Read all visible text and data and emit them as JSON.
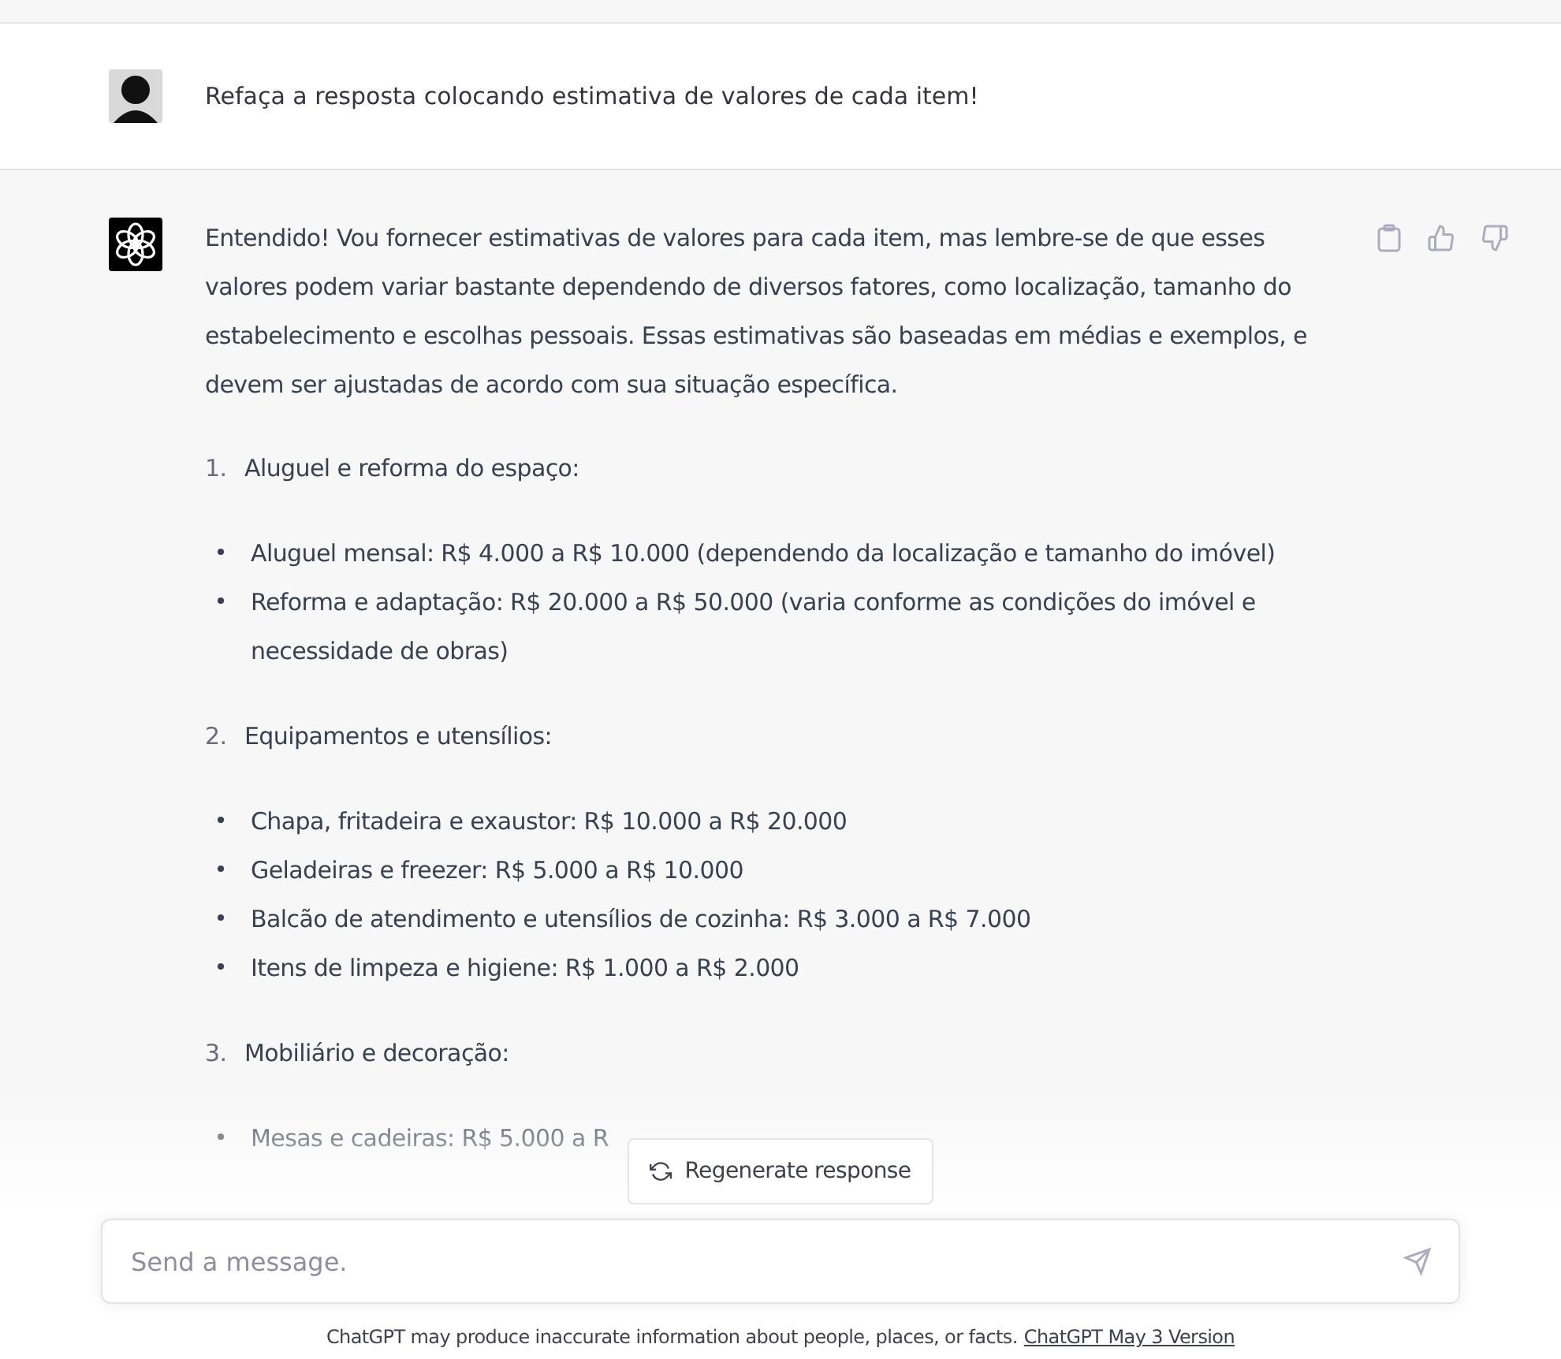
{
  "user_message": {
    "text": "Refaça a resposta colocando estimativa de valores de cada item!"
  },
  "assistant_message": {
    "intro": "Entendido! Vou fornecer estimativas de valores para cada item, mas lembre-se de que esses valores podem variar bastante dependendo de diversos fatores, como localização, tamanho do estabelecimento e escolhas pessoais. Essas estimativas são baseadas em médias e exemplos, e devem ser ajustadas de acordo com sua situação específica.",
    "sections": [
      {
        "number": "1.",
        "title": "Aluguel e reforma do espaço:",
        "items": [
          "Aluguel mensal: R$ 4.000 a R$ 10.000 (dependendo da localização e tamanho do imóvel)",
          "Reforma e adaptação: R$ 20.000 a R$ 50.000 (varia conforme as condições do imóvel e necessidade de obras)"
        ]
      },
      {
        "number": "2.",
        "title": "Equipamentos e utensílios:",
        "items": [
          "Chapa, fritadeira e exaustor: R$ 10.000 a R$ 20.000",
          "Geladeiras e freezer: R$ 5.000 a R$ 10.000",
          "Balcão de atendimento e utensílios de cozinha: R$ 3.000 a R$ 7.000",
          "Itens de limpeza e higiene: R$ 1.000 a R$ 2.000"
        ]
      },
      {
        "number": "3.",
        "title": "Mobiliário e decoração:",
        "items": [
          "Mesas e cadeiras: R$ 5.000 a R"
        ]
      }
    ]
  },
  "regenerate_button": {
    "label": "Regenerate response"
  },
  "composer": {
    "placeholder": "Send a message."
  },
  "footer": {
    "text": "ChatGPT may produce inaccurate information about people, places, or facts.",
    "link": "ChatGPT May 3 Version"
  }
}
